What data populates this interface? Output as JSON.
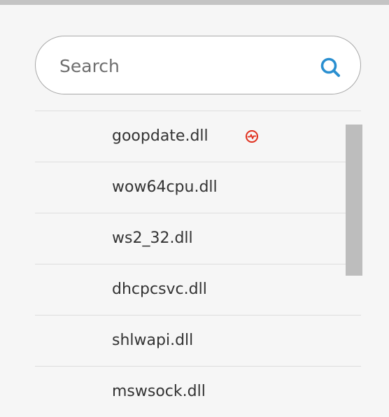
{
  "search": {
    "placeholder": "Search",
    "value": "",
    "icon": "search-icon",
    "icon_color": "#2a8fd0"
  },
  "list": {
    "items": [
      {
        "label": "goopdate.dll",
        "status_icon": "activity-alert-icon",
        "status_color": "#e0301e"
      },
      {
        "label": "wow64cpu.dll"
      },
      {
        "label": "ws2_32.dll"
      },
      {
        "label": "dhcpcsvc.dll"
      },
      {
        "label": "shlwapi.dll"
      },
      {
        "label": "mswsock.dll"
      }
    ]
  }
}
